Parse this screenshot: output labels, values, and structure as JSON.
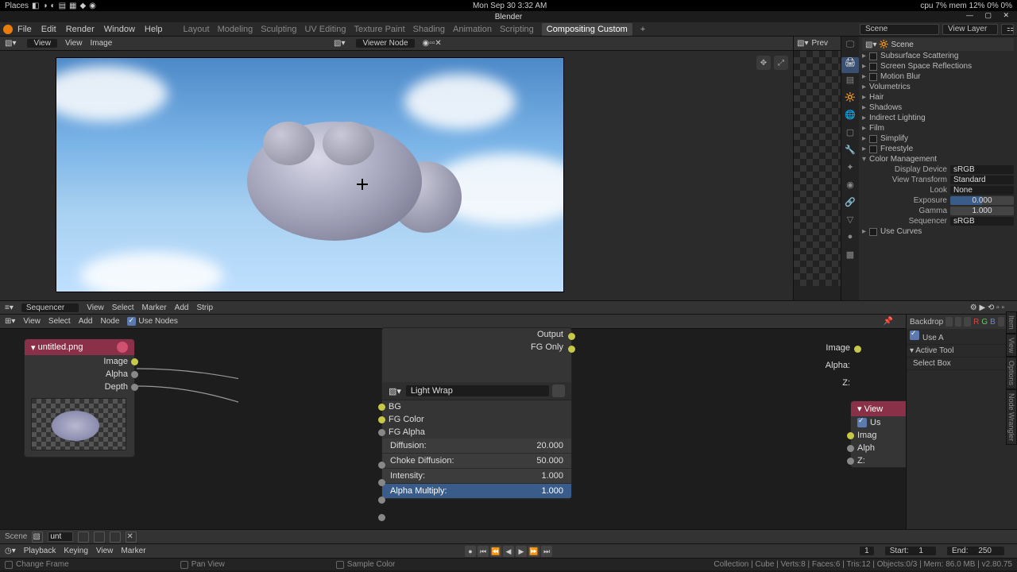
{
  "os": {
    "places": "Places",
    "datetime": "Mon Sep 30  3:32 AM",
    "stats": "cpu 7%  mem 12%  0% 0%"
  },
  "app": {
    "title": "Blender"
  },
  "menu": {
    "items": [
      "File",
      "Edit",
      "Render",
      "Window",
      "Help"
    ],
    "tabs": [
      "Layout",
      "Modeling",
      "Sculpting",
      "UV Editing",
      "Texture Paint",
      "Shading",
      "Animation",
      "Scripting"
    ],
    "tab_active": "Compositing Custom",
    "scene": "Scene",
    "viewlayer": "View Layer"
  },
  "vp": {
    "menu": [
      "View",
      "Image"
    ],
    "mode": "View",
    "center": "Viewer Node"
  },
  "props": {
    "hdr": "Scene",
    "items": [
      "Subsurface Scattering",
      "Screen Space Reflections",
      "Motion Blur",
      "Volumetrics",
      "Hair",
      "Shadows",
      "Indirect Lighting",
      "Film",
      "Simplify",
      "Freestyle",
      "Color Management"
    ],
    "cm": {
      "display_device_l": "Display Device",
      "display_device": "sRGB",
      "view_transform_l": "View Transform",
      "view_transform": "Standard",
      "look_l": "Look",
      "look": "None",
      "exposure_l": "Exposure",
      "exposure": "0.000",
      "gamma_l": "Gamma",
      "gamma": "1.000",
      "sequencer_l": "Sequencer",
      "sequencer": "sRGB",
      "curves": "Use Curves"
    }
  },
  "seq": {
    "drop": "Sequencer",
    "menu": [
      "View",
      "Select",
      "Marker",
      "Add",
      "Strip"
    ]
  },
  "nodes": {
    "menu": [
      "View",
      "Select",
      "Add",
      "Node"
    ],
    "use_nodes": "Use Nodes",
    "img": {
      "title": "untitled.png",
      "out": [
        "Image",
        "Alpha",
        "Depth"
      ]
    },
    "out_labels": {
      "output": "Output",
      "fg": "FG Only",
      "image": "Image",
      "alpha": "Alpha:",
      "z": "Z:"
    },
    "lw": {
      "title": "Light Wrap",
      "ins": [
        "BG",
        "FG Color",
        "FG Alpha"
      ],
      "params": [
        {
          "l": "Diffusion:",
          "v": "20.000"
        },
        {
          "l": "Choke Diffusion:",
          "v": "50.000"
        },
        {
          "l": "Intensity:",
          "v": "1.000"
        },
        {
          "l": "Alpha Multiply:",
          "v": "1.000"
        }
      ]
    },
    "viewer": {
      "title": "View",
      "use": "Us",
      "ins": [
        "Imag",
        "Alph",
        "Z:"
      ]
    },
    "right": {
      "backdrop": "Backdrop",
      "active": "Active Tool",
      "select": "Select Box",
      "use": "Use A"
    }
  },
  "scenefld": {
    "label": "Scene",
    "val": "unt"
  },
  "tl": {
    "menu": [
      "Playback",
      "Keying",
      "View",
      "Marker"
    ],
    "frame": "1",
    "start_l": "Start:",
    "start": "1",
    "end_l": "End:",
    "end": "250"
  },
  "status": {
    "a": "Change Frame",
    "b": "Pan View",
    "c": "Sample Color",
    "right": "Collection | Cube | Verts:8 | Faces:6 | Tris:12 | Objects:0/3 | Mem: 86.0 MB | v2.80.75"
  }
}
